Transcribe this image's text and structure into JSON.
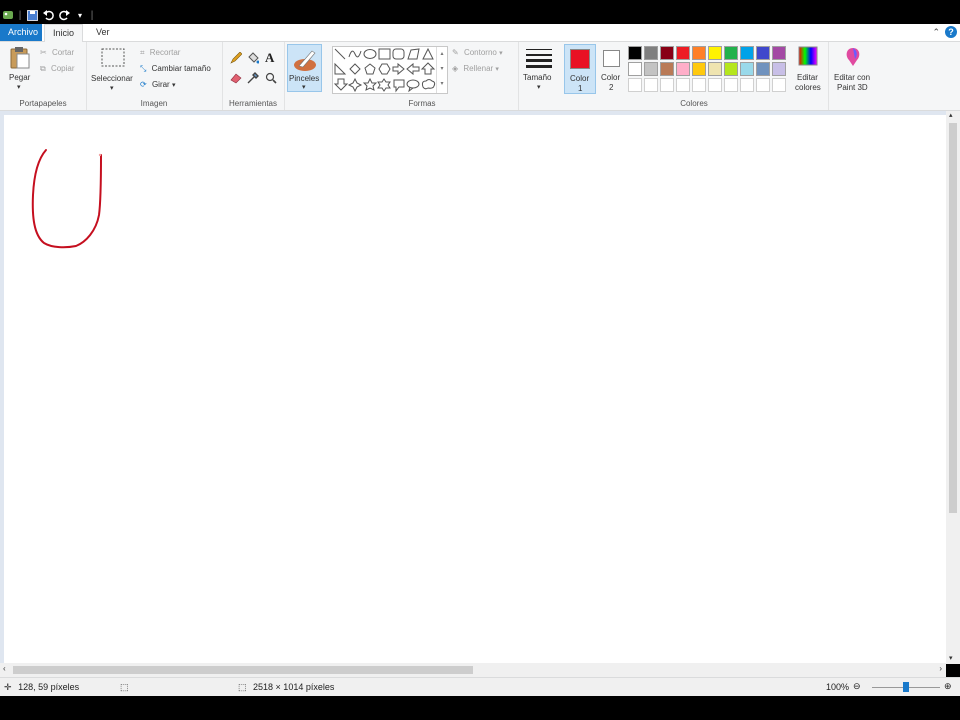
{
  "tabs": {
    "archivo": "Archivo",
    "inicio": "Inicio",
    "ver": "Ver"
  },
  "groups": {
    "portapapeles": "Portapapeles",
    "imagen": "Imagen",
    "herramientas": "Herramientas",
    "formas": "Formas",
    "colores": "Colores"
  },
  "buttons": {
    "pegar": "Pegar",
    "cortar": "Cortar",
    "copiar": "Copiar",
    "seleccionar": "Seleccionar",
    "recortar": "Recortar",
    "cambiar_tamano": "Cambiar tamaño",
    "girar": "Girar",
    "pinceles": "Pinceles",
    "contorno": "Contorno",
    "rellenar": "Rellenar",
    "tamano": "Tamaño",
    "color1_line1": "Color",
    "color1_line2": "1",
    "color2_line1": "Color",
    "color2_line2": "2",
    "editar_colores_line1": "Editar",
    "editar_colores_line2": "colores",
    "paint3d_line1": "Editar con",
    "paint3d_line2": "Paint 3D"
  },
  "colors": {
    "accent": "#1979ca",
    "color1": "#e81123",
    "color2": "#ffffff",
    "stroke": "#c50f1f",
    "palette_row1": [
      "#000000",
      "#7f7f7f",
      "#880015",
      "#ed1c24",
      "#ff7f27",
      "#fff200",
      "#22b14c",
      "#00a2e8",
      "#3f48cc",
      "#a349a4"
    ],
    "palette_row2": [
      "#ffffff",
      "#c3c3c3",
      "#b97a57",
      "#ffaec9",
      "#ffc90e",
      "#efe4b0",
      "#b5e61d",
      "#99d9ea",
      "#7092be",
      "#c8bfe7"
    ]
  },
  "status": {
    "cursor_pos": "128, 59 píxeles",
    "image_size": "2518 × 1014 píxeles",
    "zoom": "100%",
    "zoom_level": 0.5
  }
}
